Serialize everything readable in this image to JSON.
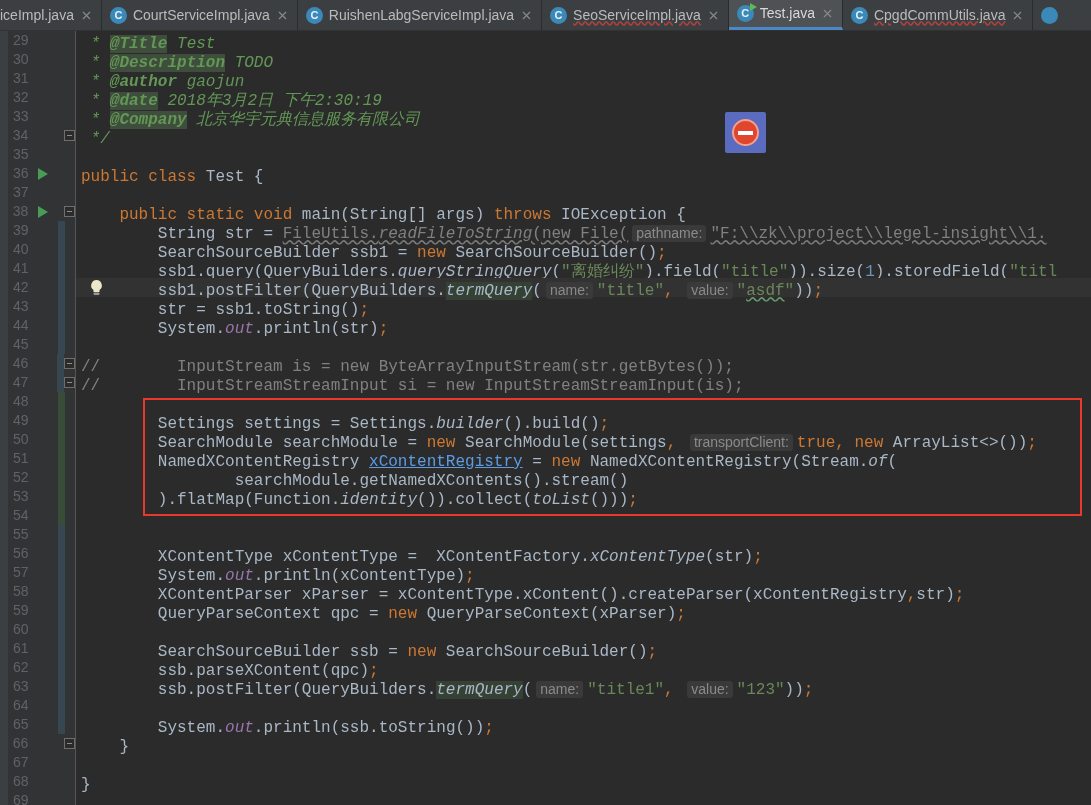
{
  "tabs": [
    {
      "label": "iceImpl.java",
      "selected": false,
      "misspelled": false
    },
    {
      "label": "CourtServiceImpl.java",
      "icon": "C",
      "selected": false,
      "misspelled": false
    },
    {
      "label": "RuishenLabgServiceImpl.java",
      "icon": "C",
      "selected": false,
      "misspelled": false
    },
    {
      "label": "SeoServiceImpl.java",
      "icon": "C",
      "selected": false,
      "misspelled": true
    },
    {
      "label": "Test.java",
      "icon": "C",
      "runnable": true,
      "selected": true,
      "misspelled": false
    },
    {
      "label": "CpgdCommUtils.java",
      "icon": "C",
      "selected": false,
      "misspelled": true
    }
  ],
  "lines": [
    {
      "number": "29",
      "tokens": [
        {
          "kind": "doc",
          "text": " * "
        },
        {
          "kind": "doctag",
          "text": "@Title"
        },
        {
          "kind": "doc",
          "text": " Test"
        }
      ]
    },
    {
      "number": "30",
      "tokens": [
        {
          "kind": "doc",
          "text": " * "
        },
        {
          "kind": "doctag",
          "text": "@Description"
        },
        {
          "kind": "doc",
          "text": " TODO"
        }
      ]
    },
    {
      "number": "31",
      "tokens": [
        {
          "kind": "doc",
          "text": " * "
        },
        {
          "kind": "docmark",
          "text": "@author"
        },
        {
          "kind": "doc",
          "text": " gaojun"
        }
      ]
    },
    {
      "number": "32",
      "tokens": [
        {
          "kind": "doc",
          "text": " * "
        },
        {
          "kind": "doctag",
          "text": "@date"
        },
        {
          "kind": "doc",
          "text": " 2018年3月2日 下午2:30:19"
        }
      ]
    },
    {
      "number": "33",
      "tokens": [
        {
          "kind": "doc",
          "text": " * "
        },
        {
          "kind": "doctag",
          "text": "@Company"
        },
        {
          "kind": "doc",
          "text": " 北京华宇元典信息服务有限公司"
        }
      ]
    },
    {
      "number": "34",
      "kind": "fold",
      "tokens": [
        {
          "kind": "doc",
          "text": " */"
        }
      ]
    },
    {
      "number": "35"
    },
    {
      "number": "36",
      "kind": "run",
      "tokens": [
        {
          "kind": "keyword",
          "text": "public class "
        },
        {
          "kind": "plain",
          "text": "Test {"
        }
      ]
    },
    {
      "number": "37"
    },
    {
      "number": "38",
      "kind": "runfold",
      "tokens": [
        {
          "kind": "keyword",
          "text": "    public static void "
        },
        {
          "kind": "plain",
          "text": "main(String[] args) "
        },
        {
          "kind": "keyword",
          "text": "throws "
        },
        {
          "kind": "plain",
          "text": "IOException {"
        }
      ]
    },
    {
      "number": "39",
      "color": "#374752",
      "tokens": [
        {
          "kind": "plain",
          "text": "        String str = "
        },
        {
          "kind": "deprecated",
          "text": "FileUtils."
        },
        {
          "kind": "obsolete",
          "text": "readFileToString"
        },
        {
          "kind": "deprecated",
          "text": "(new File("
        },
        {
          "kind": "hint",
          "text": "pathname:"
        },
        {
          "kind": "deprecated",
          "text": "\"F:\\\\zk\\\\project\\\\legel-insight\\\\1."
        }
      ]
    },
    {
      "number": "40",
      "color": "#374752",
      "tokens": [
        {
          "kind": "plain",
          "text": "        SearchSourceBuilder ssb1 = "
        },
        {
          "kind": "keyword",
          "text": "new "
        },
        {
          "kind": "plain",
          "text": "SearchSourceBuilder()"
        },
        {
          "kind": "keyword",
          "text": ";"
        }
      ]
    },
    {
      "number": "41",
      "color": "#374752",
      "tokens": [
        {
          "kind": "plain",
          "text": "        ssb1.query(QueryBuilders."
        },
        {
          "kind": "static",
          "text": "queryStringQuery"
        },
        {
          "kind": "plain",
          "text": "("
        },
        {
          "kind": "string",
          "text": "\"离婚纠纷\""
        },
        {
          "kind": "plain",
          "text": ").field("
        },
        {
          "kind": "string",
          "text": "\"title\""
        },
        {
          "kind": "plain",
          "text": ")).size("
        },
        {
          "kind": "number",
          "text": "1"
        },
        {
          "kind": "plain",
          "text": ").storedField("
        },
        {
          "kind": "string",
          "text": "\"titl"
        }
      ]
    },
    {
      "number": "42",
      "color": "#374752",
      "kind": "bulb",
      "current": true,
      "tokens": [
        {
          "kind": "plain",
          "text": "        ssb1.postFilter(QueryBuilders."
        },
        {
          "kind": "match",
          "text": "termQuery"
        },
        {
          "kind": "plain",
          "text": "("
        },
        {
          "kind": "hint",
          "text": "name:"
        },
        {
          "kind": "string",
          "text": "\"title\""
        },
        {
          "kind": "keyword",
          "text": ", "
        },
        {
          "kind": "hint",
          "text": "value:"
        },
        {
          "kind": "string",
          "text": "\""
        },
        {
          "kind": "typo",
          "text": "asdf"
        },
        {
          "kind": "string",
          "text": "\""
        },
        {
          "kind": "plain",
          "text": "))"
        },
        {
          "kind": "keyword",
          "text": ";"
        }
      ]
    },
    {
      "number": "43",
      "color": "#374752",
      "tokens": [
        {
          "kind": "plain",
          "text": "        str = ssb1.toString()"
        },
        {
          "kind": "keyword",
          "text": ";"
        }
      ]
    },
    {
      "number": "44",
      "color": "#374752",
      "tokens": [
        {
          "kind": "plain",
          "text": "        System."
        },
        {
          "kind": "field",
          "text": "out"
        },
        {
          "kind": "plain",
          "text": ".println(str)"
        },
        {
          "kind": "keyword",
          "text": ";"
        }
      ]
    },
    {
      "number": "45",
      "color": "#374752"
    },
    {
      "number": "46",
      "color": "#374752",
      "kind": "fold",
      "tokens": [
        {
          "kind": "comment",
          "text": "//        InputStream is = new ByteArrayInputStream(str.getBytes());"
        }
      ]
    },
    {
      "number": "47",
      "color": "#374752",
      "kind": "fold",
      "tokens": [
        {
          "kind": "comment",
          "text": "//        InputStreamStreamInput si = new InputStreamStreamInput(is);"
        }
      ]
    },
    {
      "number": "48",
      "color": "#384c38"
    },
    {
      "number": "49",
      "color": "#384c38",
      "tokens": [
        {
          "kind": "plain",
          "text": "        Settings settings = Settings."
        },
        {
          "kind": "static",
          "text": "builder"
        },
        {
          "kind": "plain",
          "text": "().build()"
        },
        {
          "kind": "keyword",
          "text": ";"
        }
      ]
    },
    {
      "number": "50",
      "color": "#384c38",
      "tokens": [
        {
          "kind": "plain",
          "text": "        SearchModule searchModule = "
        },
        {
          "kind": "keyword",
          "text": "new "
        },
        {
          "kind": "plain",
          "text": "SearchModule(settings"
        },
        {
          "kind": "keyword",
          "text": ", "
        },
        {
          "kind": "hint",
          "text": "transportClient:"
        },
        {
          "kind": "keyword",
          "text": "true, new "
        },
        {
          "kind": "plain",
          "text": "ArrayList<>())"
        },
        {
          "kind": "keyword",
          "text": ";"
        }
      ]
    },
    {
      "number": "51",
      "color": "#384c38",
      "tokens": [
        {
          "kind": "plain",
          "text": "        NamedXContentRegistry "
        },
        {
          "kind": "usage",
          "text": "xContentRegistry"
        },
        {
          "kind": "plain",
          "text": " = "
        },
        {
          "kind": "keyword",
          "text": "new "
        },
        {
          "kind": "plain",
          "text": "NamedXContentRegistry(Stream."
        },
        {
          "kind": "static",
          "text": "of"
        },
        {
          "kind": "plain",
          "text": "("
        }
      ]
    },
    {
      "number": "52",
      "color": "#384c38",
      "tokens": [
        {
          "kind": "plain",
          "text": "                searchModule.getNamedXContents().stream()"
        }
      ]
    },
    {
      "number": "53",
      "color": "#384c38",
      "tokens": [
        {
          "kind": "plain",
          "text": "        ).flatMap(Function."
        },
        {
          "kind": "static",
          "text": "identity"
        },
        {
          "kind": "plain",
          "text": "()).collect("
        },
        {
          "kind": "static",
          "text": "toList"
        },
        {
          "kind": "plain",
          "text": "()))"
        },
        {
          "kind": "keyword",
          "text": ";"
        }
      ]
    },
    {
      "number": "54",
      "color": "#384c38"
    },
    {
      "number": "55",
      "color": "#374752"
    },
    {
      "number": "56",
      "color": "#374752",
      "tokens": [
        {
          "kind": "plain",
          "text": "        XContentType xContentType =  XContentFactory."
        },
        {
          "kind": "static",
          "text": "xContentType"
        },
        {
          "kind": "plain",
          "text": "(str)"
        },
        {
          "kind": "keyword",
          "text": ";"
        }
      ]
    },
    {
      "number": "57",
      "color": "#374752",
      "tokens": [
        {
          "kind": "plain",
          "text": "        System."
        },
        {
          "kind": "field",
          "text": "out"
        },
        {
          "kind": "plain",
          "text": ".println(xContentType)"
        },
        {
          "kind": "keyword",
          "text": ";"
        }
      ]
    },
    {
      "number": "58",
      "color": "#374752",
      "tokens": [
        {
          "kind": "plain",
          "text": "        XContentParser xParser = xContentType.xContent().createParser(xContentRegistry"
        },
        {
          "kind": "keyword",
          "text": ","
        },
        {
          "kind": "plain",
          "text": "str)"
        },
        {
          "kind": "keyword",
          "text": ";"
        }
      ]
    },
    {
      "number": "59",
      "color": "#374752",
      "tokens": [
        {
          "kind": "plain",
          "text": "        QueryParseContext qpc = "
        },
        {
          "kind": "keyword",
          "text": "new "
        },
        {
          "kind": "plain",
          "text": "QueryParseContext(xParser)"
        },
        {
          "kind": "keyword",
          "text": ";"
        }
      ]
    },
    {
      "number": "60",
      "color": "#374752"
    },
    {
      "number": "61",
      "color": "#374752",
      "tokens": [
        {
          "kind": "plain",
          "text": "        SearchSourceBuilder ssb = "
        },
        {
          "kind": "keyword",
          "text": "new "
        },
        {
          "kind": "plain",
          "text": "SearchSourceBuilder()"
        },
        {
          "kind": "keyword",
          "text": ";"
        }
      ]
    },
    {
      "number": "62",
      "color": "#374752",
      "tokens": [
        {
          "kind": "plain",
          "text": "        ssb.parseXContent(qpc)"
        },
        {
          "kind": "keyword",
          "text": ";"
        }
      ]
    },
    {
      "number": "63",
      "color": "#374752",
      "tokens": [
        {
          "kind": "plain",
          "text": "        ssb.postFilter(QueryBuilders."
        },
        {
          "kind": "match",
          "text": "termQuery"
        },
        {
          "kind": "plain",
          "text": "("
        },
        {
          "kind": "hint",
          "text": "name:"
        },
        {
          "kind": "string",
          "text": "\"title1\""
        },
        {
          "kind": "keyword",
          "text": ", "
        },
        {
          "kind": "hint",
          "text": "value:"
        },
        {
          "kind": "string",
          "text": "\"123\""
        },
        {
          "kind": "plain",
          "text": "))"
        },
        {
          "kind": "keyword",
          "text": ";"
        }
      ]
    },
    {
      "number": "64",
      "color": "#374752"
    },
    {
      "number": "65",
      "color": "#374752",
      "tokens": [
        {
          "kind": "plain",
          "text": "        System."
        },
        {
          "kind": "field",
          "text": "out"
        },
        {
          "kind": "plain",
          "text": ".println(ssb.toString())"
        },
        {
          "kind": "keyword",
          "text": ";"
        }
      ]
    },
    {
      "number": "66",
      "kind": "fold",
      "tokens": [
        {
          "kind": "plain",
          "text": "    }"
        }
      ]
    },
    {
      "number": "67"
    },
    {
      "number": "68",
      "tokens": [
        {
          "kind": "plain",
          "text": "}"
        }
      ]
    },
    {
      "number": "69"
    }
  ]
}
